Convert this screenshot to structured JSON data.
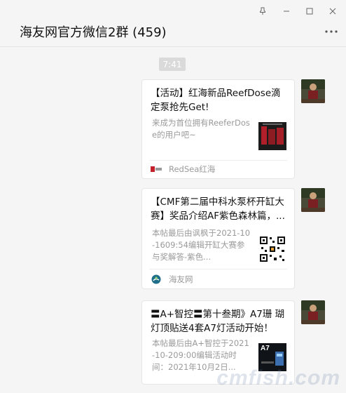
{
  "window": {
    "pin_icon": "pin-icon",
    "minimize_icon": "minimize-icon",
    "maximize_icon": "maximize-icon",
    "close_icon": "close-icon"
  },
  "chat": {
    "title": "海友网官方微信2群 (459)",
    "more_icon": "more-icon"
  },
  "timestamp": "7:41",
  "messages": [
    {
      "title": "【活动】红海新品ReefDose滴定泵抢先Get!",
      "desc": "来成为首位拥有ReeferDose的用户吧~",
      "source": "RedSea红海",
      "source_icon_text": "RedSea"
    },
    {
      "title": "【CMF第二届中科水泵杯开缸大赛】奖品介绍AF紫色森林篇，...",
      "desc": "本帖最后由讽枫于2021-10-1609:54编辑开缸大赛参与奖解答-紫色...",
      "source": "海友网"
    },
    {
      "title": "〓A+智控〓第十叁期》A7珊 瑚灯顶贴送4套A7灯活动开始！",
      "desc": "本帖最后由A+智控于2021-10-209:00编辑活动时间：2021年10月2日...",
      "thumb_text": "A7"
    }
  ],
  "watermark": "cmfish.com"
}
